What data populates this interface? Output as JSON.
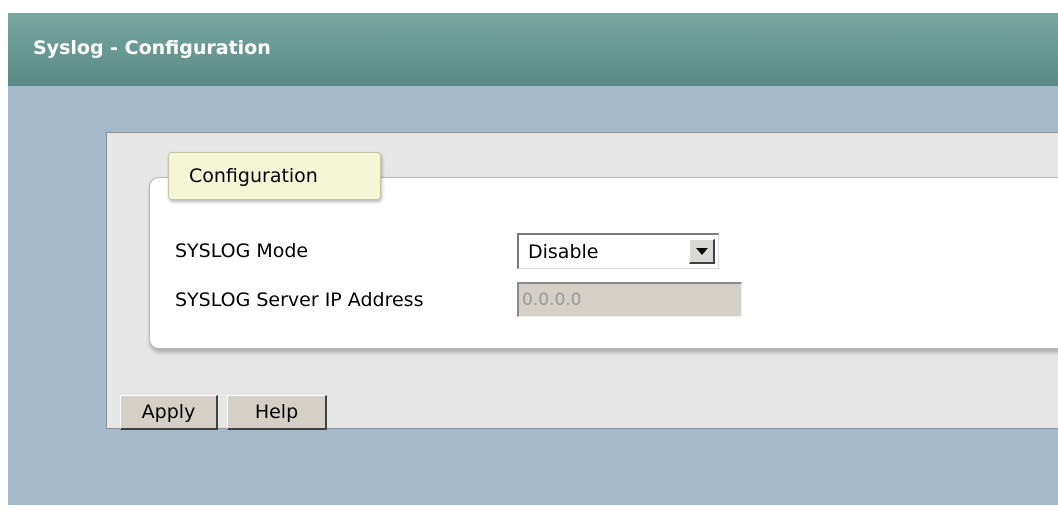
{
  "page": {
    "title": "Syslog - Configuration"
  },
  "group": {
    "legend": "Configuration"
  },
  "fields": {
    "mode_label": "SYSLOG Mode",
    "mode_value": "Disable",
    "ip_label": "SYSLOG Server IP Address",
    "ip_value": "0.0.0.0"
  },
  "buttons": {
    "apply_label": "Apply",
    "help_label": "Help"
  },
  "icons": {
    "dropdown": "chevron-down-icon"
  },
  "colors": {
    "title_bar": "#6a9a94",
    "content_bg": "#a4b9c9",
    "panel_bg": "#e6e6e6",
    "legend_bg": "#f4f6d6",
    "disabled_input_bg": "#d4d0c8"
  }
}
